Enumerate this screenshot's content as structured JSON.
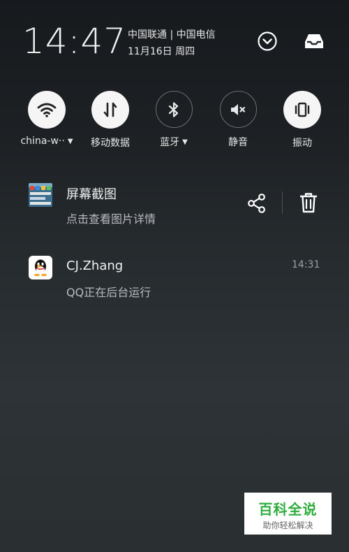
{
  "status": {
    "time": "14:47",
    "carriers": "中国联通 | 中国电信",
    "date": "11月16日 周四"
  },
  "header_icons": [
    "chevron-down-icon",
    "inbox-icon"
  ],
  "toggles": [
    {
      "label": "china-w··",
      "icon": "wifi-icon",
      "on": true,
      "has_dropdown": true
    },
    {
      "label": "移动数据",
      "icon": "mobile-data-icon",
      "on": true,
      "has_dropdown": false
    },
    {
      "label": "蓝牙",
      "icon": "bluetooth-icon",
      "on": false,
      "has_dropdown": true
    },
    {
      "label": "静音",
      "icon": "mute-icon",
      "on": false,
      "has_dropdown": false
    },
    {
      "label": "振动",
      "icon": "vibrate-icon",
      "on": true,
      "has_dropdown": false
    }
  ],
  "notifications": [
    {
      "title": "屏幕截图",
      "subtitle": "点击查看图片详情",
      "actions": [
        "share-icon",
        "trash-icon"
      ]
    },
    {
      "title": "CJ.Zhang",
      "subtitle": "QQ正在后台运行",
      "time": "14:31"
    }
  ],
  "watermark": {
    "main": "百科全说",
    "sub": "助你轻松解决"
  },
  "colors": {
    "toggle_on": "#f5f5f5",
    "icon_dark": "#222222",
    "watermark_green": "#2fae3f"
  }
}
